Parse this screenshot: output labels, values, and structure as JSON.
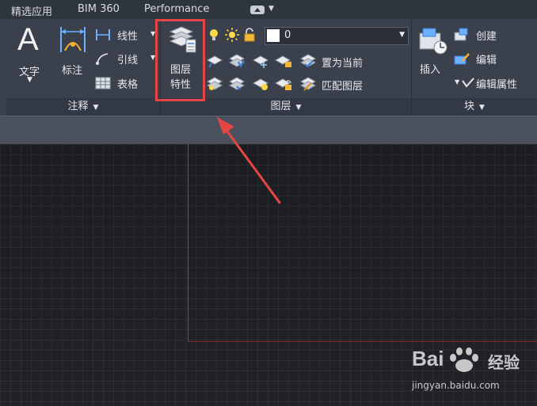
{
  "tabs": [
    {
      "label": "精选应用"
    },
    {
      "label": "BIM 360"
    },
    {
      "label": "Performance"
    }
  ],
  "annotate": {
    "text_label": "文字",
    "dim_label": "标注",
    "linear_label": "线性",
    "leader_label": "引线",
    "table_label": "表格",
    "panel_title": "注释"
  },
  "layers": {
    "properties_label_1": "图层",
    "properties_label_2": "特性",
    "current_layer": "0",
    "set_current_label": "置为当前",
    "match_label": "匹配图层",
    "panel_title": "图层",
    "swatch_color": "#ffffff"
  },
  "block": {
    "insert_label": "插入",
    "create_label": "创建",
    "edit_label": "编辑",
    "edit_attr_label": "编辑属性",
    "panel_title": "块"
  },
  "watermark": {
    "brand": "Bai",
    "cn": "经验",
    "url": "jingyan.baidu.com"
  },
  "colors": {
    "highlight": "#e54545",
    "arrow": "#e54545",
    "ribbon": "#3a414c",
    "canvas": "#212227"
  }
}
